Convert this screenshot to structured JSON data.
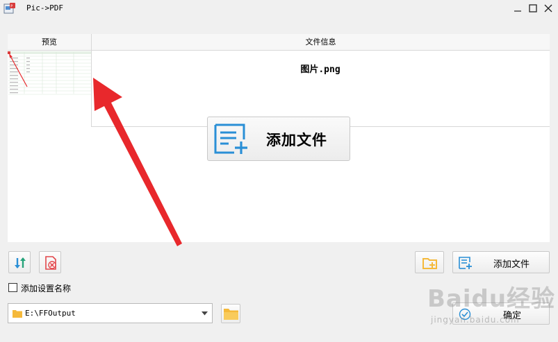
{
  "window": {
    "title": "Pic->PDF",
    "controls": {
      "minimize": "minimize-icon",
      "maximize": "maximize-icon",
      "close": "close-icon"
    }
  },
  "file_table": {
    "columns": [
      "预览",
      "文件信息"
    ],
    "rows": [
      {
        "filename": "图片.png"
      }
    ]
  },
  "big_add_button": {
    "label": "添加文件",
    "icon": "add-file-icon"
  },
  "toolbar": {
    "sort_icon": "sort-arrows-icon",
    "clear_icon": "delete-file-icon",
    "add_folder_icon": "add-folder-icon",
    "add_file_label": "添加文件"
  },
  "options": {
    "add_setting_name_label": "添加设置名称",
    "checked": false
  },
  "output": {
    "path": "E:\\FFOutput"
  },
  "confirm_label": "确定",
  "watermark": {
    "brand": "Baidu经验",
    "url": "jingyan.baidu.com"
  },
  "colors": {
    "accent_blue": "#2a8fd6",
    "folder_yellow": "#f5b93a",
    "arrow_red": "#e8282c",
    "clear_red": "#e2474b"
  }
}
